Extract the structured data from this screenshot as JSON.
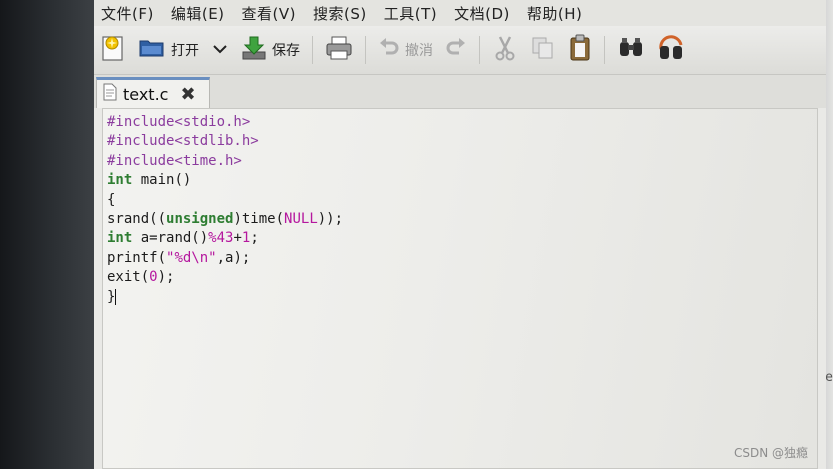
{
  "menubar": {
    "items": [
      "文件(F)",
      "编辑(E)",
      "查看(V)",
      "搜索(S)",
      "工具(T)",
      "文档(D)",
      "帮助(H)"
    ]
  },
  "toolbar": {
    "open_label": "打开",
    "save_label": "保存",
    "undo_label": "撤消"
  },
  "tab": {
    "filename": "text.c",
    "close_glyph": "✖"
  },
  "editor": {
    "lines": [
      "#include<stdio.h>",
      "#include<stdlib.h>",
      "#include<time.h>",
      "int main()",
      "{",
      "srand((unsigned)time(NULL));",
      "int a=rand()%43+1;",
      "printf(\"%d\\n\",a);",
      "exit(0);",
      "}"
    ]
  },
  "watermark": "CSDN @独瘾",
  "edge_text": "te"
}
